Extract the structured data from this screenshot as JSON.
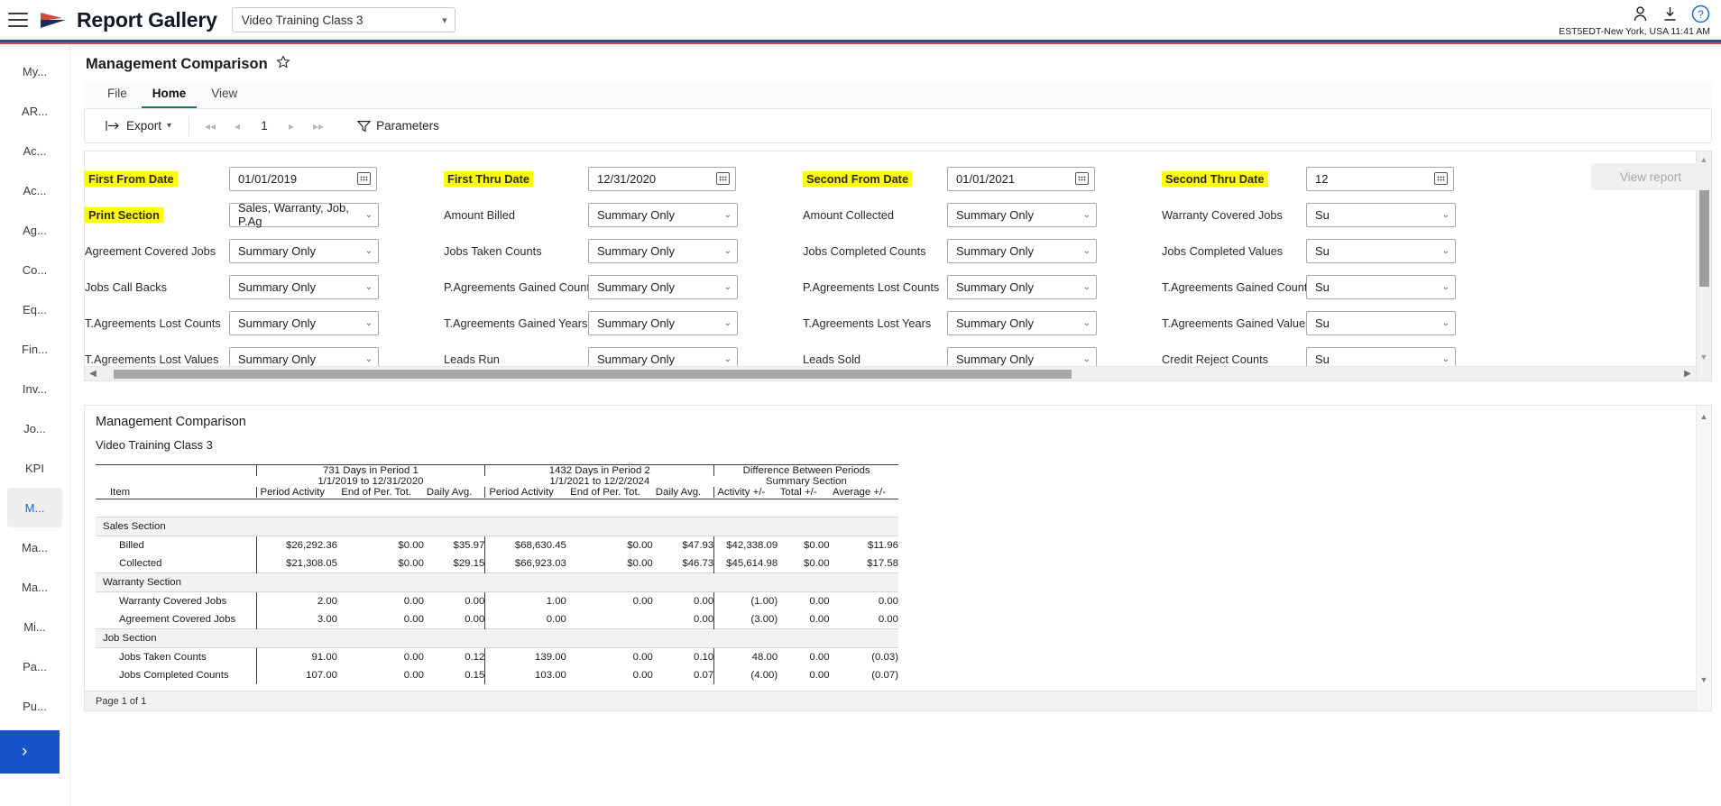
{
  "topbar": {
    "brand": "Report Gallery",
    "app_selector_value": "Video Training Class 3",
    "timezone_text": "EST5EDT-New York, USA 11:41 AM",
    "icons": {
      "menu": "hamburger-icon",
      "user": "user-icon",
      "download": "download-icon",
      "help": "help-icon"
    }
  },
  "sidebar": {
    "items": [
      {
        "label": "My...",
        "active": false
      },
      {
        "label": "AR...",
        "active": false
      },
      {
        "label": "Ac...",
        "active": false
      },
      {
        "label": "Ac...",
        "active": false
      },
      {
        "label": "Ag...",
        "active": false
      },
      {
        "label": "Co...",
        "active": false
      },
      {
        "label": "Eq...",
        "active": false
      },
      {
        "label": "Fin...",
        "active": false
      },
      {
        "label": "Inv...",
        "active": false
      },
      {
        "label": "Jo...",
        "active": false
      },
      {
        "label": "KPI",
        "active": false
      },
      {
        "label": "M...",
        "active": true
      },
      {
        "label": "Ma...",
        "active": false
      },
      {
        "label": "Ma...",
        "active": false
      },
      {
        "label": "Mi...",
        "active": false
      },
      {
        "label": "Pa...",
        "active": false
      },
      {
        "label": "Pu...",
        "active": false
      }
    ],
    "expand_label": "›"
  },
  "report": {
    "title": "Management Comparison",
    "favorite_icon": "star-outline-icon"
  },
  "ribbon": {
    "tabs": [
      {
        "label": "File",
        "active": false
      },
      {
        "label": "Home",
        "active": true
      },
      {
        "label": "View",
        "active": false
      }
    ],
    "export_label": "Export",
    "page_number": "1",
    "parameters_label": "Parameters"
  },
  "parameters": {
    "rows": [
      [
        {
          "label": "First From Date",
          "highlight": true,
          "value": "01/01/2019",
          "kind": "date"
        },
        {
          "label": "First Thru Date",
          "highlight": true,
          "value": "12/31/2020",
          "kind": "date"
        },
        {
          "label": "Second From Date",
          "highlight": true,
          "value": "01/01/2021",
          "kind": "date"
        },
        {
          "label": "Second Thru Date",
          "highlight": true,
          "value": "12",
          "kind": "date"
        }
      ],
      [
        {
          "label": "Print Section",
          "highlight": true,
          "value": "Sales, Warranty, Job, P.Ag",
          "kind": "select"
        },
        {
          "label": "Amount Billed",
          "highlight": false,
          "value": "Summary Only",
          "kind": "select"
        },
        {
          "label": "Amount Collected",
          "highlight": false,
          "value": "Summary Only",
          "kind": "select"
        },
        {
          "label": "Warranty Covered Jobs",
          "highlight": false,
          "value": "Su",
          "kind": "select"
        }
      ],
      [
        {
          "label": "Agreement Covered Jobs",
          "highlight": false,
          "value": "Summary Only",
          "kind": "select"
        },
        {
          "label": "Jobs Taken Counts",
          "highlight": false,
          "value": "Summary Only",
          "kind": "select"
        },
        {
          "label": "Jobs Completed Counts",
          "highlight": false,
          "value": "Summary Only",
          "kind": "select"
        },
        {
          "label": "Jobs Completed Values",
          "highlight": false,
          "value": "Su",
          "kind": "select"
        }
      ],
      [
        {
          "label": "Jobs Call Backs",
          "highlight": false,
          "value": "Summary Only",
          "kind": "select"
        },
        {
          "label": "P.Agreements Gained Counts",
          "highlight": false,
          "value": "Summary Only",
          "kind": "select"
        },
        {
          "label": "P.Agreements Lost Counts",
          "highlight": false,
          "value": "Summary Only",
          "kind": "select"
        },
        {
          "label": "T.Agreements Gained Counts",
          "highlight": false,
          "value": "Su",
          "kind": "select"
        }
      ],
      [
        {
          "label": "T.Agreements Lost Counts",
          "highlight": false,
          "value": "Summary Only",
          "kind": "select"
        },
        {
          "label": "T.Agreements Gained Years",
          "highlight": false,
          "value": "Summary Only",
          "kind": "select"
        },
        {
          "label": "T.Agreements Lost Years",
          "highlight": false,
          "value": "Summary Only",
          "kind": "select"
        },
        {
          "label": "T.Agreements Gained Values",
          "highlight": false,
          "value": "Su",
          "kind": "select"
        }
      ],
      [
        {
          "label": "T.Agreements Lost Values",
          "highlight": false,
          "value": "Summary Only",
          "kind": "select"
        },
        {
          "label": "Leads Run",
          "highlight": false,
          "value": "Summary Only",
          "kind": "select"
        },
        {
          "label": "Leads Sold",
          "highlight": false,
          "value": "Summary Only",
          "kind": "select"
        },
        {
          "label": "Credit Reject Counts",
          "highlight": false,
          "value": "Su",
          "kind": "select"
        }
      ]
    ],
    "view_report_label": "View report"
  },
  "viewer": {
    "doc_title": "Management Comparison",
    "doc_subtitle": "Video Training Class 3",
    "group_headers": [
      {
        "line1": "731 Days in Period 1",
        "line2": "1/1/2019 to 12/31/2020"
      },
      {
        "line1": "1432 Days in Period 2",
        "line2": "1/1/2021 to 12/2/2024"
      },
      {
        "line1": "Difference Between Periods",
        "line2": "Summary Section"
      }
    ],
    "columns": [
      "Item",
      "Period Activity",
      "End of Per. Tot.",
      "Daily Avg.",
      "Period Activity",
      "End of Per. Tot.",
      "Daily Avg.",
      "Activity +/-",
      "Total +/-",
      "Average +/-"
    ],
    "sections": [
      {
        "name": "Sales Section",
        "rows": [
          {
            "item": "Billed",
            "cells": [
              "$26,292.36",
              "$0.00",
              "$35.97",
              "$68,630.45",
              "$0.00",
              "$47.93",
              "$42,338.09",
              "$0.00",
              "$11.96"
            ]
          },
          {
            "item": "Collected",
            "cells": [
              "$21,308.05",
              "$0.00",
              "$29.15",
              "$66,923.03",
              "$0.00",
              "$46.73",
              "$45,614.98",
              "$0.00",
              "$17.58"
            ]
          }
        ]
      },
      {
        "name": "Warranty Section",
        "rows": [
          {
            "item": "Warranty Covered Jobs",
            "cells": [
              "2.00",
              "0.00",
              "0.00",
              "1.00",
              "0.00",
              "0.00",
              "(1.00)",
              "0.00",
              "0.00"
            ]
          },
          {
            "item": "Agreement Covered Jobs",
            "cells": [
              "3.00",
              "0.00",
              "0.00",
              "0.00",
              "",
              "0.00",
              "(3.00)",
              "0.00",
              "0.00"
            ]
          }
        ]
      },
      {
        "name": "Job Section",
        "rows": [
          {
            "item": "Jobs Taken Counts",
            "cells": [
              "91.00",
              "0.00",
              "0.12",
              "139.00",
              "0.00",
              "0.10",
              "48.00",
              "0.00",
              "(0.03)"
            ]
          },
          {
            "item": "Jobs Completed Counts",
            "cells": [
              "107.00",
              "0.00",
              "0.15",
              "103.00",
              "0.00",
              "0.07",
              "(4.00)",
              "0.00",
              "(0.07)"
            ]
          }
        ]
      }
    ],
    "page_footer": "Page 1 of 1"
  },
  "colors": {
    "brand_navy": "#2c4b8c",
    "brand_red": "#d9483c",
    "accent_teal": "#14766a",
    "highlight_yellow": "#ffff00",
    "sidebar_active_blue": "#1964c8"
  }
}
